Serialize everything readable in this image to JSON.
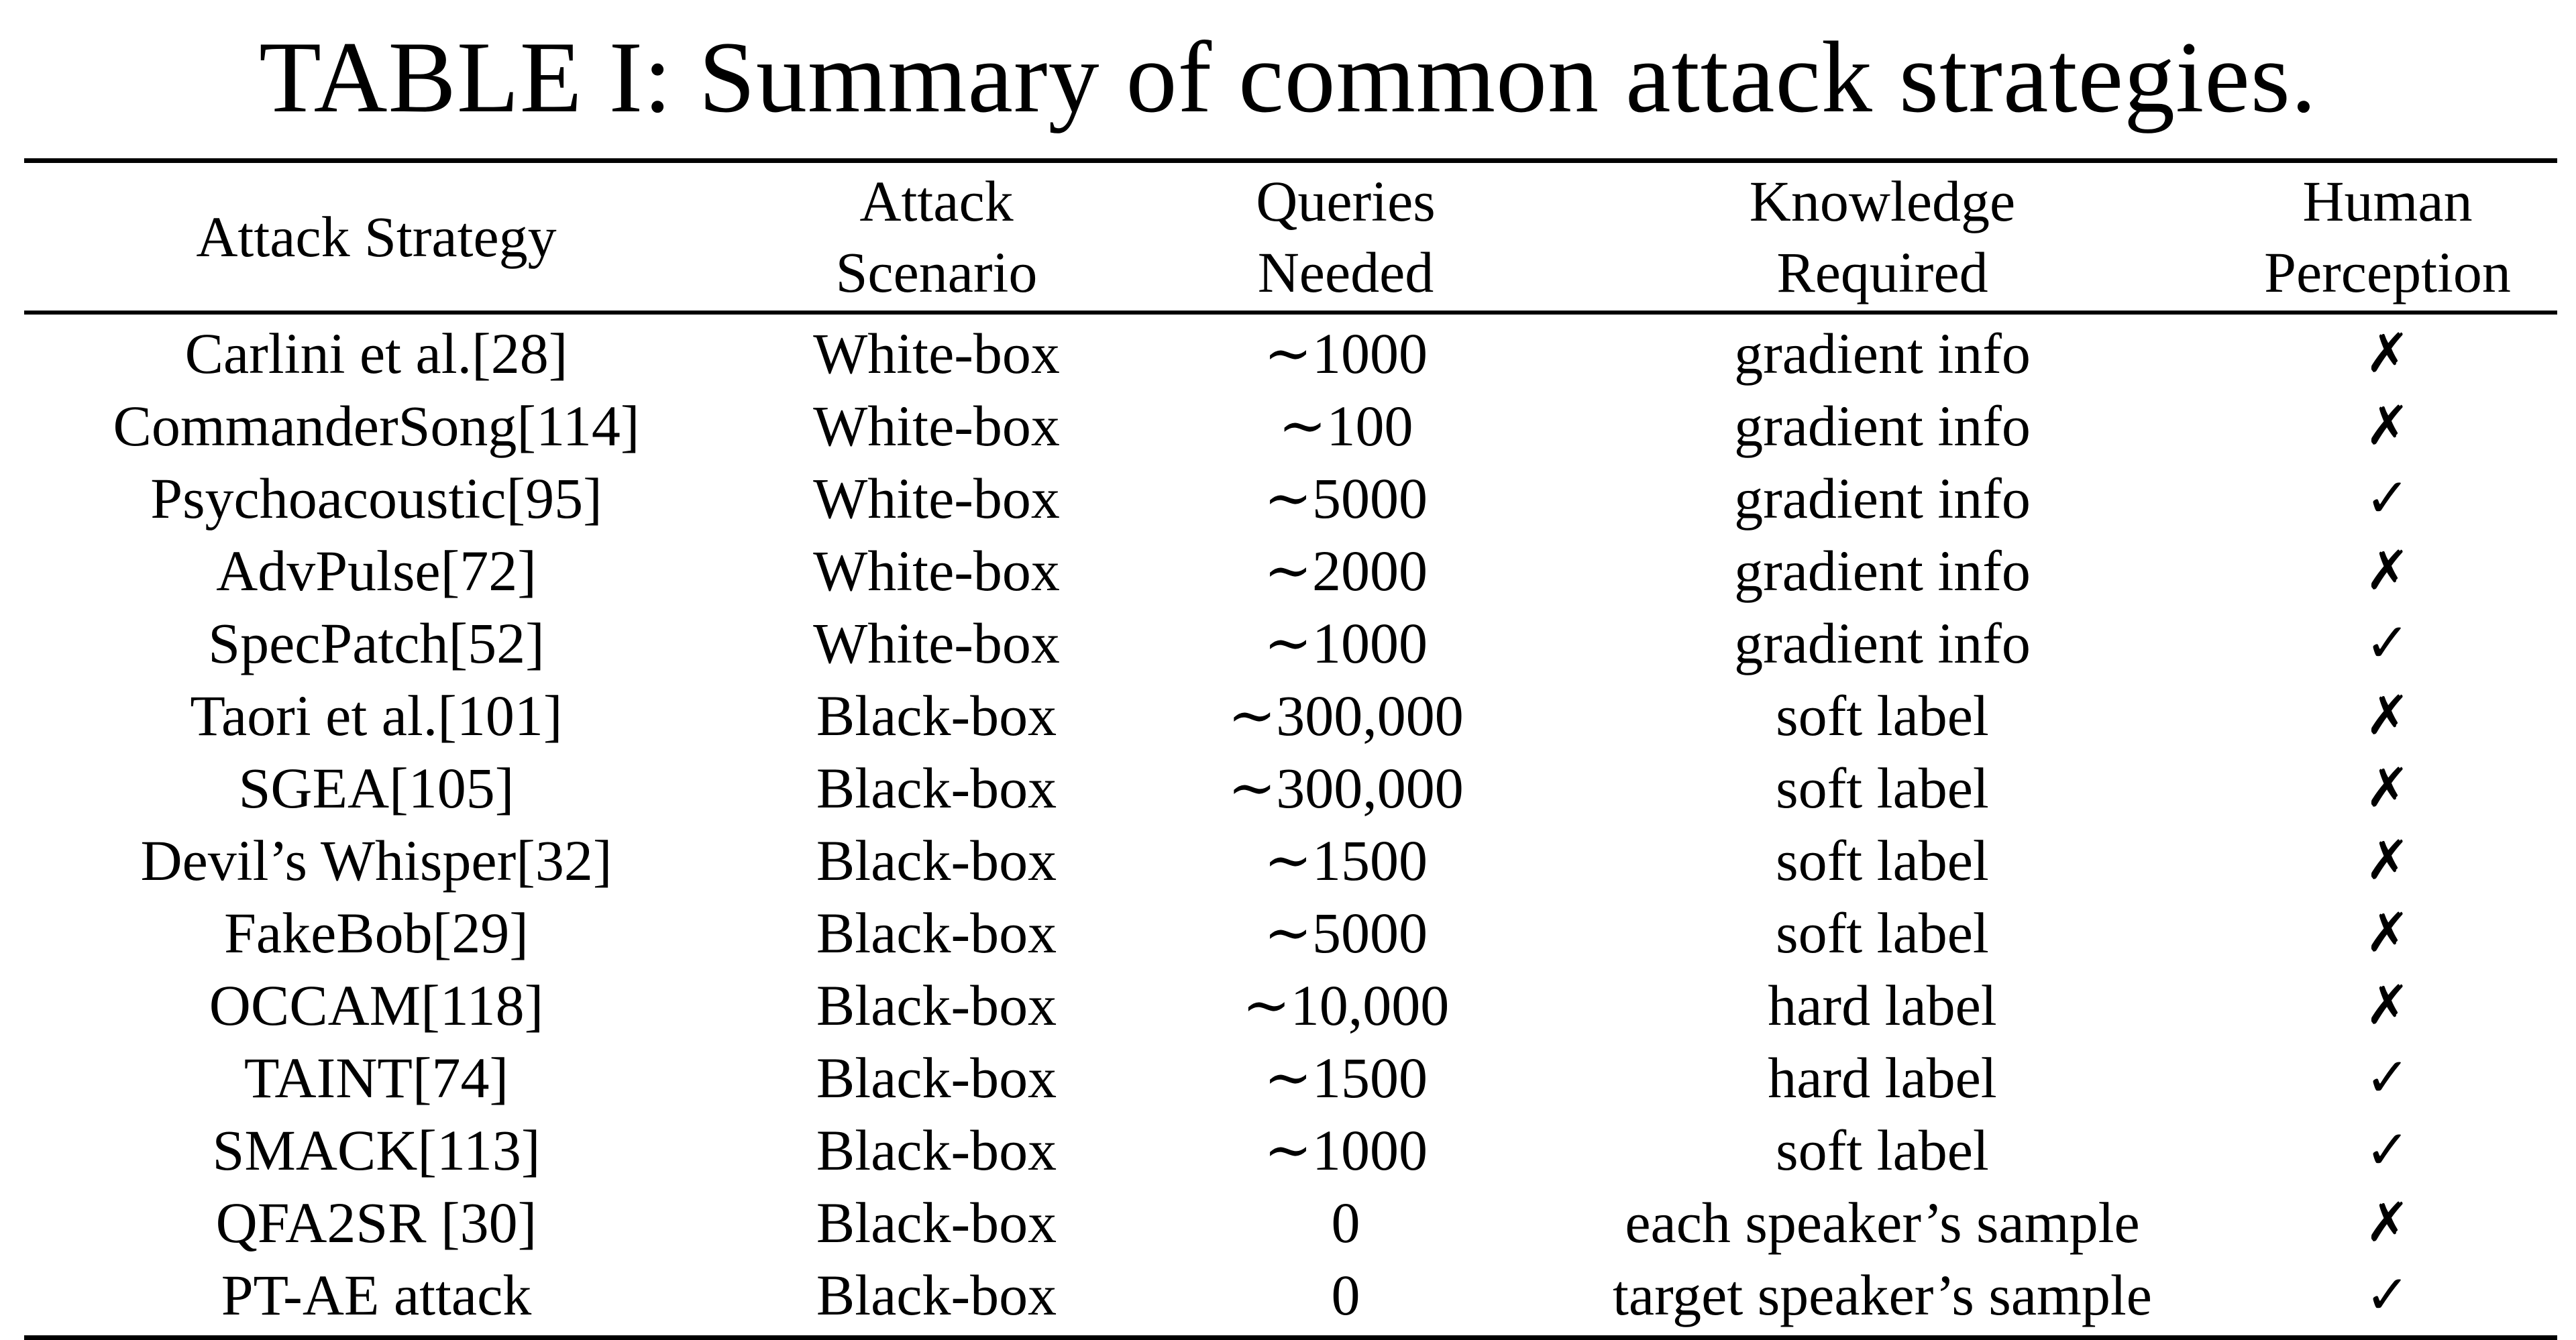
{
  "caption": "TABLE I: Summary of common attack strategies.",
  "headers": {
    "strategy": "Attack Strategy",
    "scenario_line1": "Attack",
    "scenario_line2": "Scenario",
    "queries_line1": "Queries",
    "queries_line2": "Needed",
    "knowledge_line1": "Knowledge",
    "knowledge_line2": "Required",
    "perception_line1": "Human",
    "perception_line2": "Perception"
  },
  "symbols": {
    "check": "✓",
    "cross": "✗"
  },
  "rows": [
    {
      "strategy": "Carlini et al.[28]",
      "scenario": "White-box",
      "queries": "∼1000",
      "knowledge": "gradient info",
      "perception": "✗"
    },
    {
      "strategy": "CommanderSong[114]",
      "scenario": "White-box",
      "queries": "∼100",
      "knowledge": "gradient info",
      "perception": "✗"
    },
    {
      "strategy": "Psychoacoustic[95]",
      "scenario": "White-box",
      "queries": "∼5000",
      "knowledge": "gradient info",
      "perception": "✓"
    },
    {
      "strategy": "AdvPulse[72]",
      "scenario": "White-box",
      "queries": "∼2000",
      "knowledge": "gradient info",
      "perception": "✗"
    },
    {
      "strategy": "SpecPatch[52]",
      "scenario": "White-box",
      "queries": "∼1000",
      "knowledge": "gradient info",
      "perception": "✓"
    },
    {
      "strategy": "Taori et al.[101]",
      "scenario": "Black-box",
      "queries": "∼300,000",
      "knowledge": "soft label",
      "perception": "✗"
    },
    {
      "strategy": "SGEA[105]",
      "scenario": "Black-box",
      "queries": "∼300,000",
      "knowledge": "soft label",
      "perception": "✗"
    },
    {
      "strategy": "Devil’s Whisper[32]",
      "scenario": "Black-box",
      "queries": "∼1500",
      "knowledge": "soft label",
      "perception": "✗"
    },
    {
      "strategy": "FakeBob[29]",
      "scenario": "Black-box",
      "queries": "∼5000",
      "knowledge": "soft label",
      "perception": "✗"
    },
    {
      "strategy": "OCCAM[118]",
      "scenario": "Black-box",
      "queries": "∼10,000",
      "knowledge": "hard label",
      "perception": "✗"
    },
    {
      "strategy": "TAINT[74]",
      "scenario": "Black-box",
      "queries": "∼1500",
      "knowledge": "hard label",
      "perception": "✓"
    },
    {
      "strategy": "SMACK[113]",
      "scenario": "Black-box",
      "queries": "∼1000",
      "knowledge": "soft label",
      "perception": "✓"
    },
    {
      "strategy": "QFA2SR [30]",
      "scenario": "Black-box",
      "queries": "0",
      "knowledge": "each speaker’s sample",
      "perception": "✗"
    },
    {
      "strategy": "PT-AE attack",
      "scenario": "Black-box",
      "queries": "0",
      "knowledge": "target speaker’s sample",
      "perception": "✓"
    }
  ]
}
